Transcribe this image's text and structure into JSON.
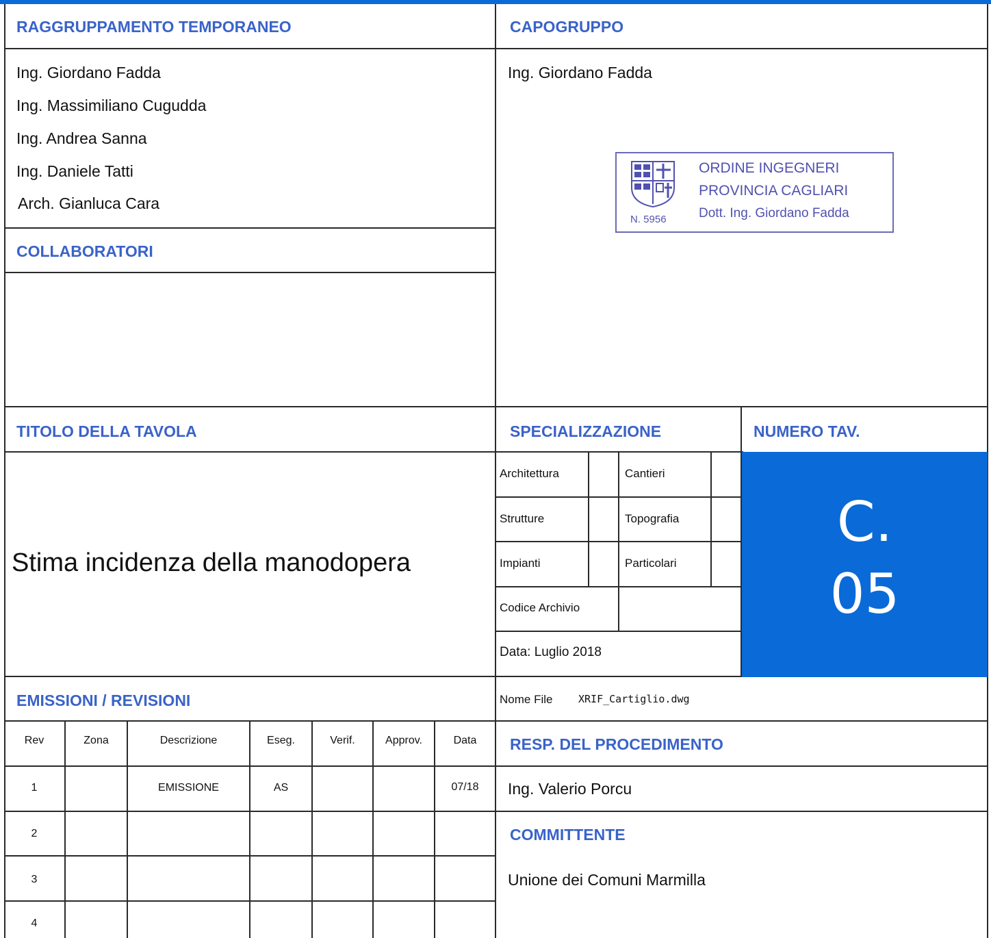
{
  "raggruppamento": {
    "header": "RAGGRUPPAMENTO TEMPORANEO",
    "members": [
      "Ing. Giordano Fadda",
      "Ing. Massimiliano Cugudda",
      "Ing. Andrea Sanna",
      "Ing. Daniele Tatti",
      "Arch. Gianluca Cara"
    ]
  },
  "capogruppo": {
    "header": "CAPOGRUPPO",
    "name": "Ing. Giordano Fadda"
  },
  "stamp": {
    "line1": "ORDINE  INGEGNERI",
    "line2": "PROVINCIA CAGLIARI",
    "line3": "Dott. Ing. Giordano Fadda",
    "number": "N. 5956"
  },
  "collaboratori": {
    "header": "COLLABORATORI"
  },
  "titolo": {
    "header": "TITOLO DELLA TAVOLA",
    "value": "Stima incidenza della manodopera"
  },
  "specializzazione": {
    "header": "SPECIALIZZAZIONE",
    "left": [
      "Architettura",
      "Strutture",
      "Impianti"
    ],
    "right": [
      "Cantieri",
      "Topografia",
      "Particolari"
    ],
    "codice": "Codice Archivio",
    "data": "Data: Luglio 2018"
  },
  "numero": {
    "header": "NUMERO TAV.",
    "line1": "C.",
    "line2": "05"
  },
  "file": {
    "label": "Nome File",
    "value": "XRIF_Cartiglio.dwg"
  },
  "emissioni": {
    "header": "EMISSIONI / REVISIONI",
    "columns": [
      "Rev",
      "Zona",
      "Descrizione",
      "Eseg.",
      "Verif.",
      "Approv.",
      "Data"
    ],
    "rows": [
      [
        "1",
        "",
        "EMISSIONE",
        "AS",
        "",
        "",
        "07/18"
      ],
      [
        "2",
        "",
        "",
        "",
        "",
        "",
        ""
      ],
      [
        "3",
        "",
        "",
        "",
        "",
        "",
        ""
      ],
      [
        "4",
        "",
        "",
        "",
        "",
        "",
        ""
      ]
    ]
  },
  "responsabile": {
    "header": "RESP. DEL PROCEDIMENTO",
    "name": "Ing. Valerio Porcu"
  },
  "committente": {
    "header": "COMMITTENTE",
    "name": "Unione dei Comuni Marmilla"
  },
  "colors": {
    "accent": "#0a6ad8",
    "header_text": "#3a63c9",
    "stamp": "#5151b0"
  }
}
